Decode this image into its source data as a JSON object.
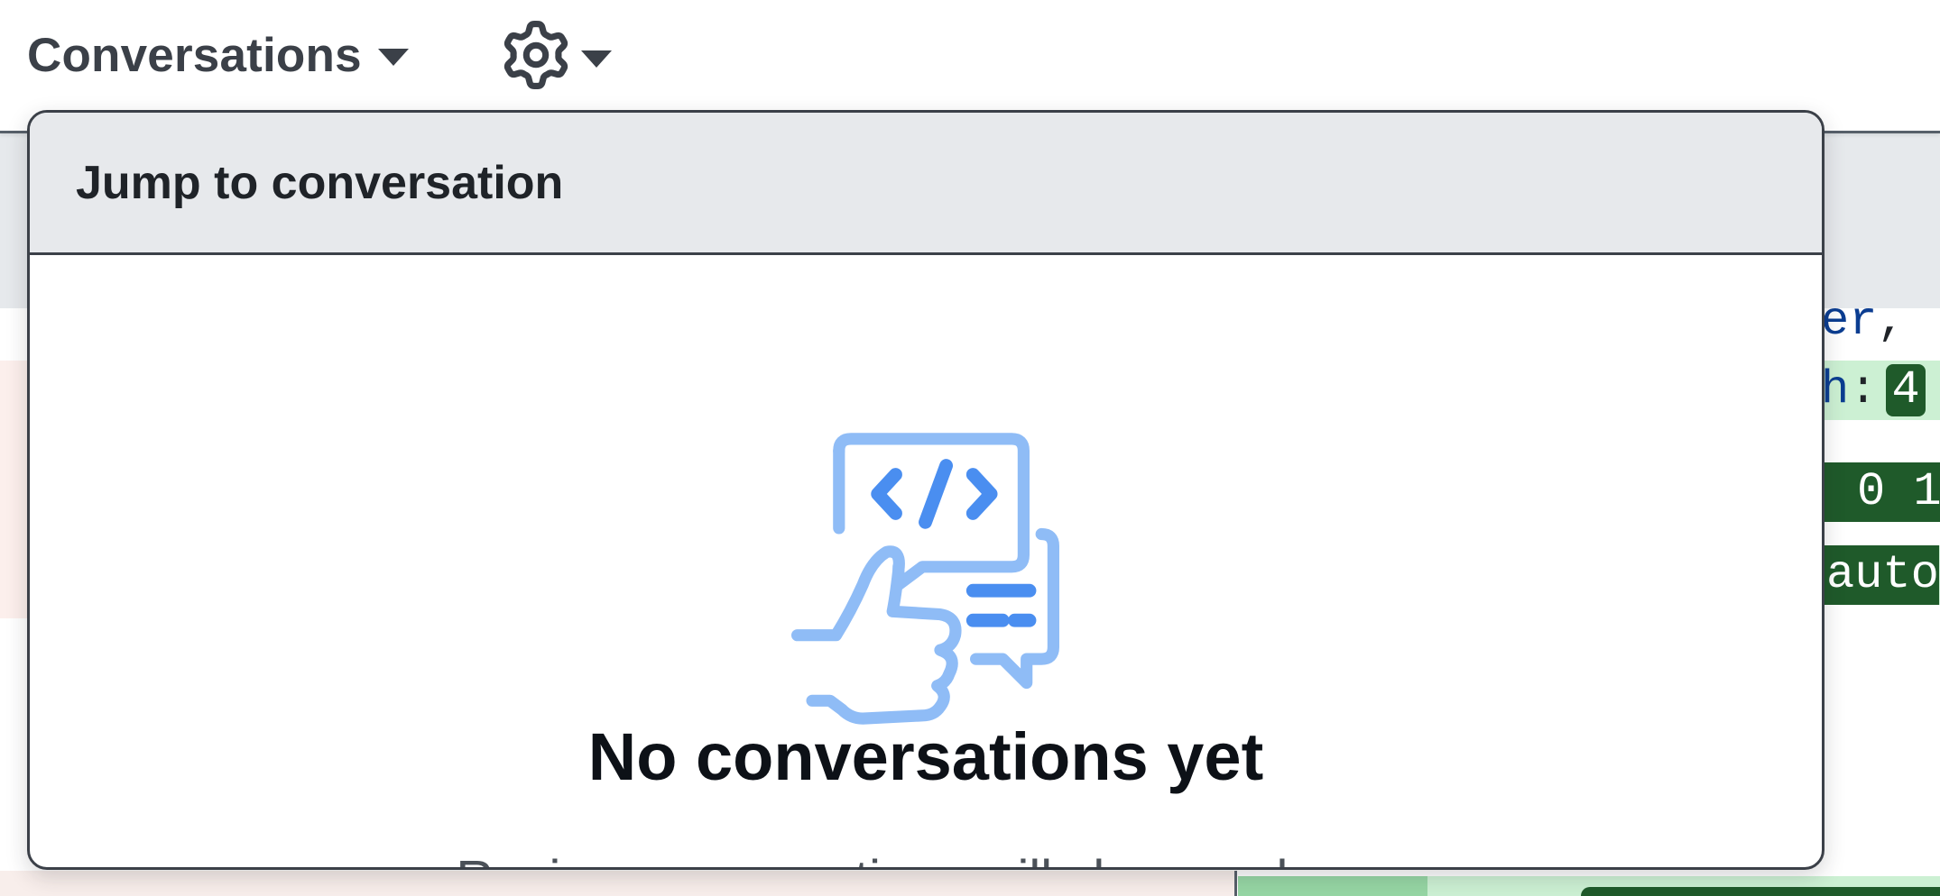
{
  "toolbar": {
    "conversations_label": "Conversations",
    "settings_icon": "gear-icon"
  },
  "background_code": {
    "line1": {
      "text": "er",
      "punct": ","
    },
    "line2": {
      "text": "h",
      "punct": ":",
      "highlight": "4"
    },
    "line3": {
      "text": "0 1"
    },
    "line4": {
      "text": "auto"
    }
  },
  "popover": {
    "title": "Jump to conversation",
    "empty_state": {
      "icon": "code-review-thumbs-up-icon",
      "heading": "No conversations yet",
      "description": "Review conversations will show up here."
    }
  },
  "colors": {
    "popover_header_bg": "#e7e9ec",
    "border": "#3b4048",
    "illustration_light": "#8fbcf6",
    "illustration_dark": "#4a8ef0",
    "diff_added_bg": "#ccf0d3",
    "diff_added_highlight": "#1f5a2a",
    "diff_removed_bg": "#fcefec"
  }
}
